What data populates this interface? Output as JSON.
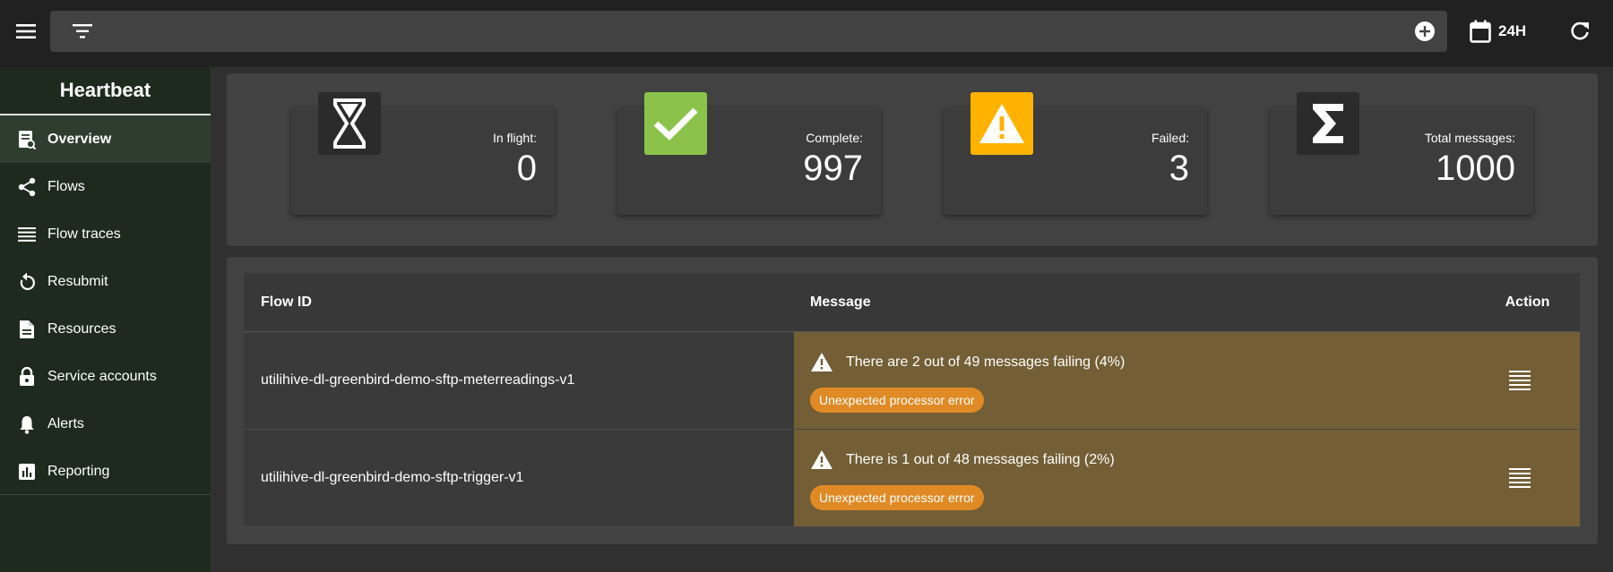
{
  "header": {
    "search": {
      "value": "",
      "placeholder": ""
    },
    "time_range_label": "24H",
    "icons": {
      "menu": "hamburger-icon",
      "filter": "filter-icon",
      "add": "add-circle-icon",
      "calendar": "calendar-icon",
      "refresh": "refresh-icon"
    }
  },
  "sidebar": {
    "title": "Heartbeat",
    "items": [
      {
        "label": "Overview",
        "icon": "overview-icon",
        "active": true
      },
      {
        "label": "Flows",
        "icon": "flows-icon"
      },
      {
        "label": "Flow traces",
        "icon": "list-icon"
      },
      {
        "label": "Resubmit",
        "icon": "resubmit-icon"
      },
      {
        "label": "Resources",
        "icon": "document-icon"
      },
      {
        "label": "Service accounts",
        "icon": "lock-icon"
      },
      {
        "label": "Alerts",
        "icon": "bell-icon"
      },
      {
        "label": "Reporting",
        "icon": "chart-icon"
      }
    ]
  },
  "stats": {
    "in_flight": {
      "label": "In flight:",
      "value": "0",
      "icon": "hourglass-icon",
      "color": "#2b2b2b"
    },
    "complete": {
      "label": "Complete:",
      "value": "997",
      "icon": "check-icon",
      "color": "#8bc34a"
    },
    "failed": {
      "label": "Failed:",
      "value": "3",
      "icon": "warning-icon",
      "color": "#ffb300"
    },
    "total": {
      "label": "Total messages:",
      "value": "1000",
      "icon": "sigma-icon",
      "color": "#2b2b2b"
    }
  },
  "table": {
    "headers": {
      "flow_id": "Flow ID",
      "message": "Message",
      "action": "Action"
    },
    "rows": [
      {
        "flow_id": "utilihive-dl-greenbird-demo-sftp-meterreadings-v1",
        "message": "There are 2 out of 49 messages failing (4%)",
        "tag": "Unexpected processor error"
      },
      {
        "flow_id": "utilihive-dl-greenbird-demo-sftp-trigger-v1",
        "message": "There is 1 out of 48 messages failing (2%)",
        "tag": "Unexpected processor error"
      }
    ]
  },
  "colors": {
    "row_warning": "#735e35",
    "chip": "#e08a26",
    "sidebar_bg": "#1f2a1f"
  }
}
